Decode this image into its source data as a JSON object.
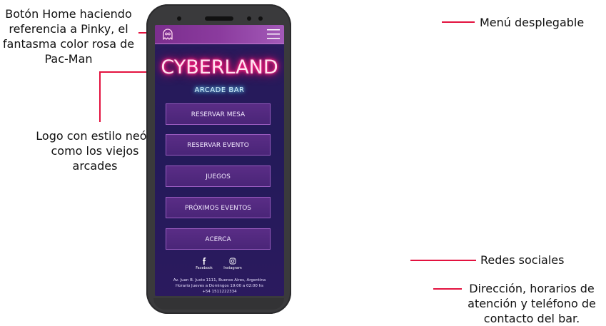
{
  "annotations": {
    "home_button": [
      "Botón Home haciendo",
      "referencia a Pinky, el",
      "fantasma color rosa de",
      "Pac-Man"
    ],
    "logo": [
      "Logo con estilo neón",
      "como los viejos",
      "arcades"
    ],
    "menu": "Menú desplegable",
    "social": "Redes sociales",
    "contact": [
      "Dirección, horarios de",
      "atención y teléfono de",
      "contacto del bar."
    ]
  },
  "app": {
    "logo": "CYBERLAND",
    "subtitle": "ARCADE BAR",
    "buttons": [
      "RESERVAR MESA",
      "RESERVAR EVENTO",
      "JUEGOS",
      "PRÓXIMOS EVENTOS",
      "ACERCA"
    ],
    "social": [
      {
        "label": "Facebook",
        "icon": "facebook-icon"
      },
      {
        "label": "Instagram",
        "icon": "instagram-icon"
      }
    ],
    "footer": [
      "Av. Juan B. Justo 1111, Buenos Aires, Argentina",
      "Horario Jueves a Domingos 19:00 a 02:00 hs",
      "+54 1511222334"
    ]
  },
  "colors": {
    "annotation_line": "#e3123f",
    "neon_pink": "#ff1a7a",
    "neon_cyan": "#34c8ff",
    "screen_bg": "#231a5a"
  }
}
